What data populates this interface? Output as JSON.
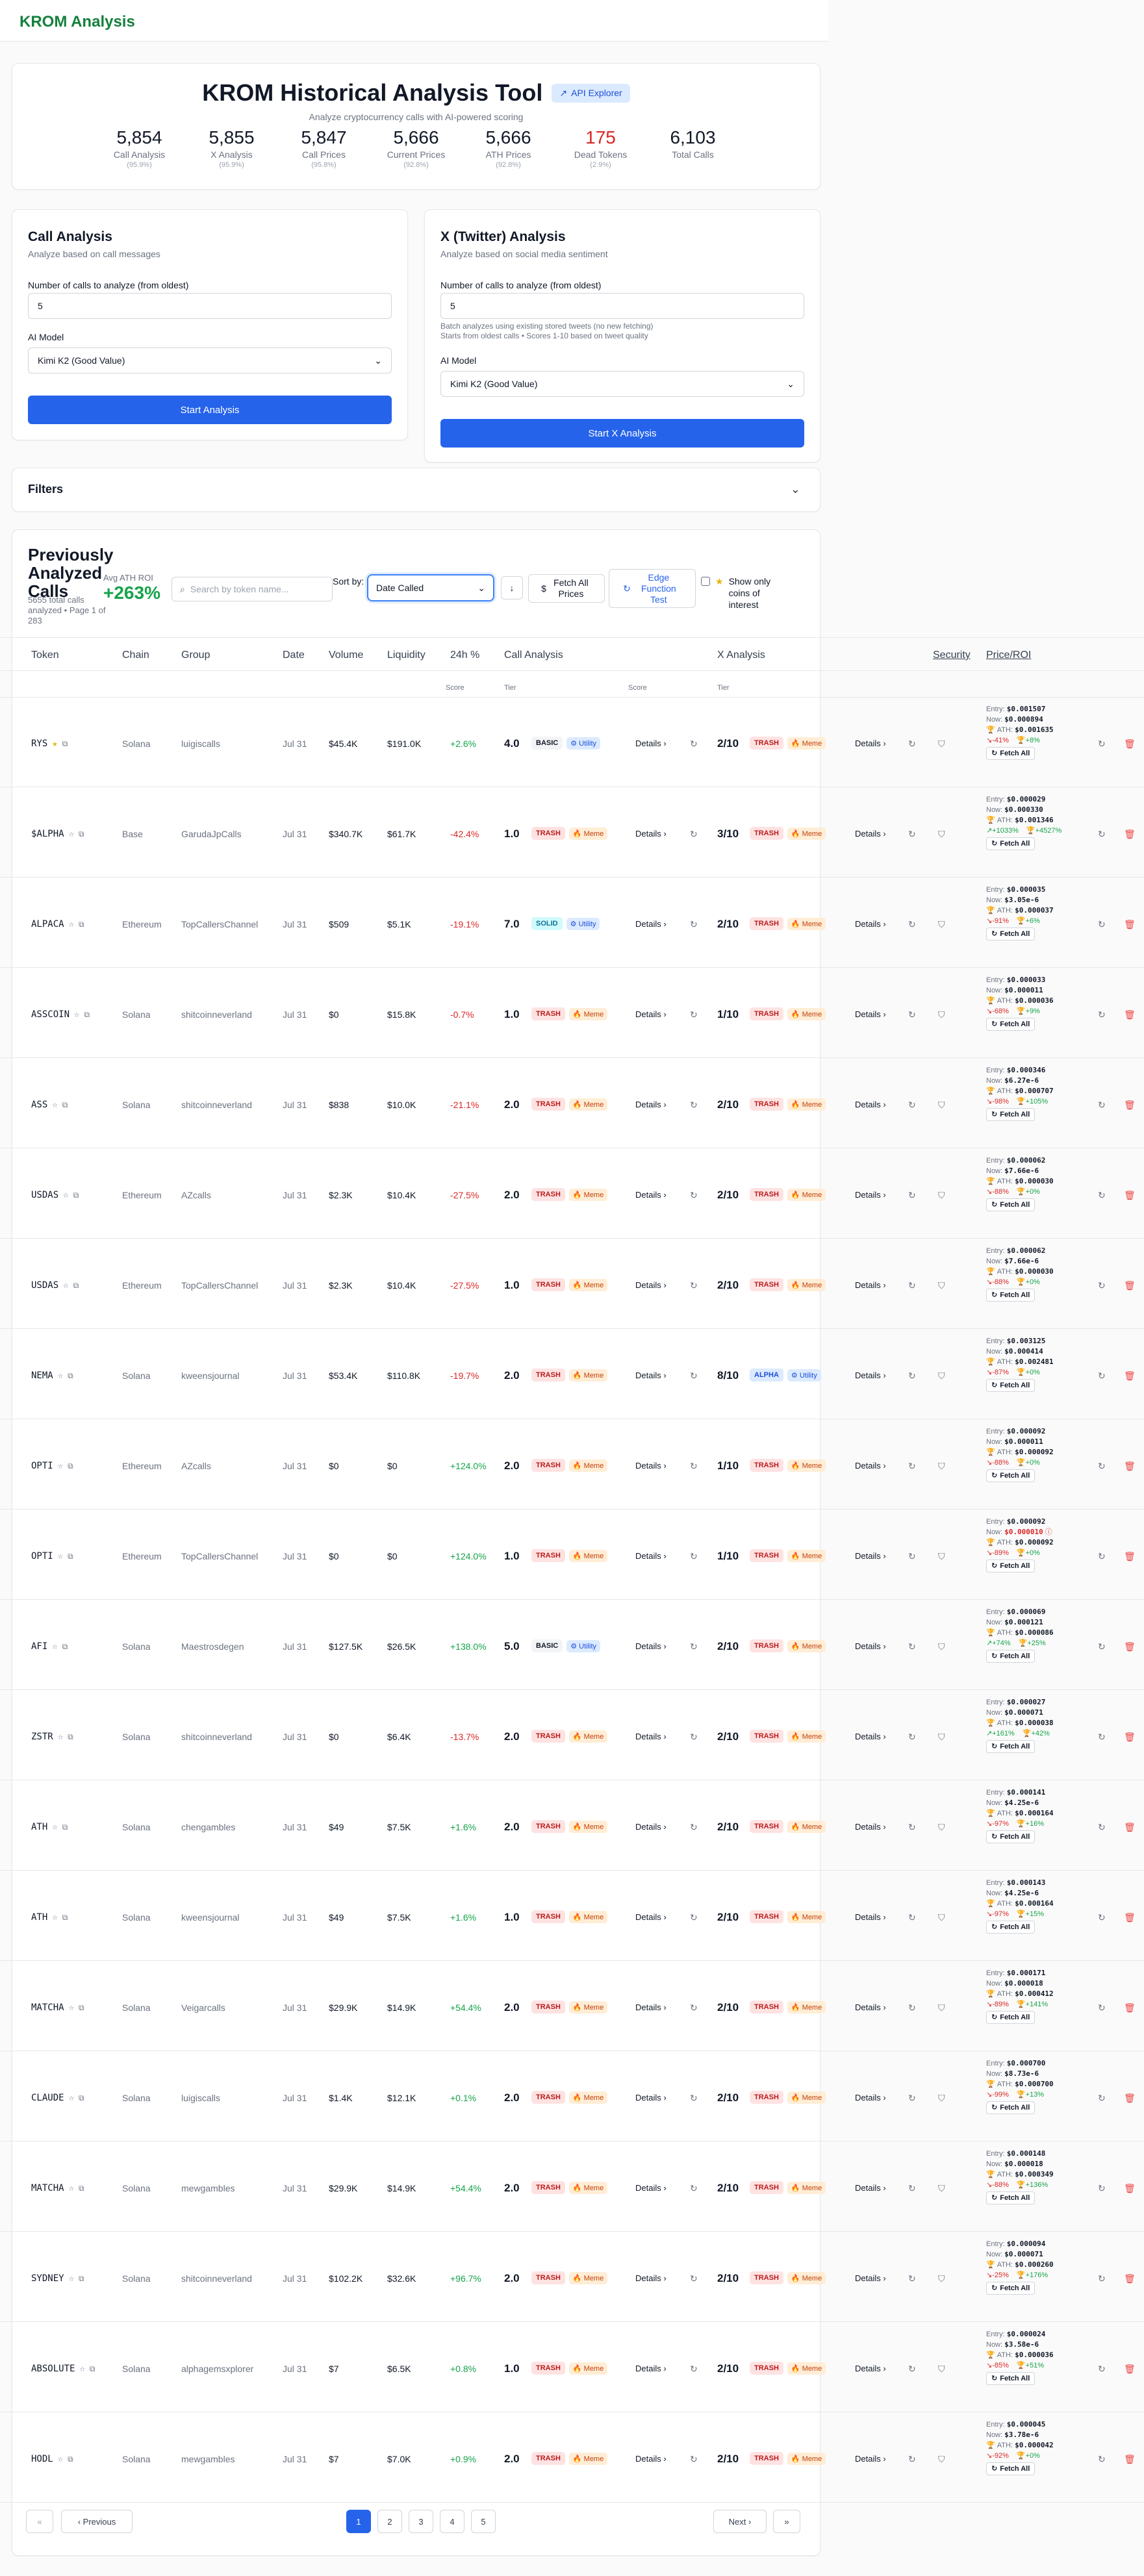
{
  "app": {
    "title": "KROM Analysis"
  },
  "hero": {
    "title": "KROM Historical Analysis Tool",
    "api_explorer": "API Explorer",
    "subtitle": "Analyze cryptocurrency calls with AI-powered scoring",
    "stats": [
      {
        "value": "5,854",
        "label": "Call Analysis",
        "pct": "(95.9%)"
      },
      {
        "value": "5,855",
        "label": "X Analysis",
        "pct": "(95.9%)"
      },
      {
        "value": "5,847",
        "label": "Call Prices",
        "pct": "(95.8%)"
      },
      {
        "value": "5,666",
        "label": "Current Prices",
        "pct": "(92.8%)"
      },
      {
        "value": "5,666",
        "label": "ATH Prices",
        "pct": "(92.8%)"
      },
      {
        "value": "175",
        "label": "Dead Tokens",
        "pct": "(2.9%)"
      },
      {
        "value": "6,103",
        "label": "Total Calls",
        "pct": ""
      }
    ]
  },
  "call_analysis": {
    "title": "Call Analysis",
    "subtitle": "Analyze based on call messages",
    "count_label": "Number of calls to analyze (from oldest)",
    "count_value": "5",
    "model_label": "AI Model",
    "model_value": "Kimi K2 (Good Value)",
    "button": "Start Analysis"
  },
  "x_analysis": {
    "title": "X (Twitter) Analysis",
    "subtitle": "Analyze based on social media sentiment",
    "count_label": "Number of calls to analyze (from oldest)",
    "count_value": "5",
    "hint1": "Batch analyzes using existing stored tweets (no new fetching)",
    "hint2": "Starts from oldest calls • Scores 1-10 based on tweet quality",
    "model_label": "AI Model",
    "model_value": "Kimi K2 (Good Value)",
    "button": "Start X Analysis"
  },
  "filters": {
    "label": "Filters"
  },
  "table_header": {
    "title": "Previously Analyzed Calls",
    "meta": "5655 total calls analyzed • Page 1 of 283",
    "roi_label": "Avg ATH ROI",
    "roi_value": "+263%",
    "search_placeholder": "Search by token name...",
    "sort_label": "Sort by:",
    "sort_value": "Date Called",
    "fetch_all": "Fetch All Prices",
    "edge_test": "Edge Function Test",
    "interest_label": "Show only coins of interest"
  },
  "columns": {
    "token": "Token",
    "chain": "Chain",
    "group": "Group",
    "date": "Date",
    "volume": "Volume",
    "liquidity": "Liquidity",
    "change": "24h %",
    "call_analysis": "Call Analysis",
    "x_analysis": "X Analysis",
    "security": "Security",
    "price": "Price/ROI",
    "score": "Score",
    "tier": "Tier"
  },
  "labels": {
    "details": "Details ›",
    "entry": "Entry:",
    "now": "Now:",
    "ath": "ATH:",
    "fetch_all": "Fetch All"
  },
  "rows": [
    {
      "token": "RYS",
      "starred": true,
      "chain": "Solana",
      "group": "luigiscalls",
      "date": "Jul 31",
      "volume": "$45.4K",
      "liquidity": "$191.0K",
      "change": "+2.6%",
      "call_score": "4.0",
      "call_tier": "BASIC",
      "call_tag": "Utility",
      "x_score": "2/10",
      "x_tier": "TRASH",
      "x_tag": "Meme",
      "entry": "$0.001507",
      "now": "$0.000894",
      "now_red": false,
      "ath": "$0.001635",
      "roi_now": "-41%",
      "roi_ath": "+8%"
    },
    {
      "token": "$ALPHA",
      "starred": false,
      "chain": "Base",
      "group": "GarudaJpCalls",
      "date": "Jul 31",
      "volume": "$340.7K",
      "liquidity": "$61.7K",
      "change": "-42.4%",
      "call_score": "1.0",
      "call_tier": "TRASH",
      "call_tag": "Meme",
      "x_score": "3/10",
      "x_tier": "TRASH",
      "x_tag": "Meme",
      "entry": "$0.000029",
      "now": "$0.000330",
      "now_red": false,
      "ath": "$0.001346",
      "roi_now": "+1033%",
      "roi_ath": "+4527%"
    },
    {
      "token": "ALPACA",
      "starred": false,
      "chain": "Ethereum",
      "group": "TopCallersChannel",
      "date": "Jul 31",
      "volume": "$509",
      "liquidity": "$5.1K",
      "change": "-19.1%",
      "call_score": "7.0",
      "call_tier": "SOLID",
      "call_tag": "Utility",
      "x_score": "2/10",
      "x_tier": "TRASH",
      "x_tag": "Meme",
      "entry": "$0.000035",
      "now": "$3.05e-6",
      "now_red": false,
      "ath": "$0.000037",
      "roi_now": "-91%",
      "roi_ath": "+6%"
    },
    {
      "token": "ASSCOIN",
      "starred": false,
      "chain": "Solana",
      "group": "shitcoinneverland",
      "date": "Jul 31",
      "volume": "$0",
      "liquidity": "$15.8K",
      "change": "-0.7%",
      "call_score": "1.0",
      "call_tier": "TRASH",
      "call_tag": "Meme",
      "x_score": "1/10",
      "x_tier": "TRASH",
      "x_tag": "Meme",
      "entry": "$0.000033",
      "now": "$0.000011",
      "now_red": false,
      "ath": "$0.000036",
      "roi_now": "-68%",
      "roi_ath": "+9%"
    },
    {
      "token": "ASS",
      "starred": false,
      "chain": "Solana",
      "group": "shitcoinneverland",
      "date": "Jul 31",
      "volume": "$838",
      "liquidity": "$10.0K",
      "change": "-21.1%",
      "call_score": "2.0",
      "call_tier": "TRASH",
      "call_tag": "Meme",
      "x_score": "2/10",
      "x_tier": "TRASH",
      "x_tag": "Meme",
      "entry": "$0.000346",
      "now": "$6.27e-6",
      "now_red": false,
      "ath": "$0.000707",
      "roi_now": "-98%",
      "roi_ath": "+105%"
    },
    {
      "token": "USDAS",
      "starred": false,
      "chain": "Ethereum",
      "group": "AZcalls",
      "date": "Jul 31",
      "volume": "$2.3K",
      "liquidity": "$10.4K",
      "change": "-27.5%",
      "call_score": "2.0",
      "call_tier": "TRASH",
      "call_tag": "Meme",
      "x_score": "2/10",
      "x_tier": "TRASH",
      "x_tag": "Meme",
      "entry": "$0.000062",
      "now": "$7.66e-6",
      "now_red": false,
      "ath": "$0.000030",
      "roi_now": "-88%",
      "roi_ath": "+0%"
    },
    {
      "token": "USDAS",
      "starred": false,
      "chain": "Ethereum",
      "group": "TopCallersChannel",
      "date": "Jul 31",
      "volume": "$2.3K",
      "liquidity": "$10.4K",
      "change": "-27.5%",
      "call_score": "1.0",
      "call_tier": "TRASH",
      "call_tag": "Meme",
      "x_score": "2/10",
      "x_tier": "TRASH",
      "x_tag": "Meme",
      "entry": "$0.000062",
      "now": "$7.66e-6",
      "now_red": false,
      "ath": "$0.000030",
      "roi_now": "-88%",
      "roi_ath": "+0%"
    },
    {
      "token": "NEMA",
      "starred": false,
      "chain": "Solana",
      "group": "kweensjournal",
      "date": "Jul 31",
      "volume": "$53.4K",
      "liquidity": "$110.8K",
      "change": "-19.7%",
      "call_score": "2.0",
      "call_tier": "TRASH",
      "call_tag": "Meme",
      "x_score": "8/10",
      "x_tier": "ALPHA",
      "x_tag": "Utility",
      "entry": "$0.003125",
      "now": "$0.000414",
      "now_red": false,
      "ath": "$0.002481",
      "roi_now": "-87%",
      "roi_ath": "+0%"
    },
    {
      "token": "OPTI",
      "starred": false,
      "chain": "Ethereum",
      "group": "AZcalls",
      "date": "Jul 31",
      "volume": "$0",
      "liquidity": "$0",
      "change": "+124.0%",
      "call_score": "2.0",
      "call_tier": "TRASH",
      "call_tag": "Meme",
      "x_score": "1/10",
      "x_tier": "TRASH",
      "x_tag": "Meme",
      "entry": "$0.000092",
      "now": "$0.000011",
      "now_red": false,
      "ath": "$0.000092",
      "roi_now": "-88%",
      "roi_ath": "+0%"
    },
    {
      "token": "OPTI",
      "starred": false,
      "chain": "Ethereum",
      "group": "TopCallersChannel",
      "date": "Jul 31",
      "volume": "$0",
      "liquidity": "$0",
      "change": "+124.0%",
      "call_score": "1.0",
      "call_tier": "TRASH",
      "call_tag": "Meme",
      "x_score": "1/10",
      "x_tier": "TRASH",
      "x_tag": "Meme",
      "entry": "$0.000092",
      "now": "$0.000010",
      "now_red": true,
      "ath": "$0.000092",
      "roi_now": "-89%",
      "roi_ath": "+0%"
    },
    {
      "token": "AFI",
      "starred": false,
      "chain": "Solana",
      "group": "Maestrosdegen",
      "date": "Jul 31",
      "volume": "$127.5K",
      "liquidity": "$26.5K",
      "change": "+138.0%",
      "call_score": "5.0",
      "call_tier": "BASIC",
      "call_tag": "Utility",
      "x_score": "2/10",
      "x_tier": "TRASH",
      "x_tag": "Meme",
      "entry": "$0.000069",
      "now": "$0.000121",
      "now_red": false,
      "ath": "$0.000086",
      "roi_now": "+74%",
      "roi_ath": "+25%"
    },
    {
      "token": "ZSTR",
      "starred": false,
      "chain": "Solana",
      "group": "shitcoinneverland",
      "date": "Jul 31",
      "volume": "$0",
      "liquidity": "$6.4K",
      "change": "-13.7%",
      "call_score": "2.0",
      "call_tier": "TRASH",
      "call_tag": "Meme",
      "x_score": "2/10",
      "x_tier": "TRASH",
      "x_tag": "Meme",
      "entry": "$0.000027",
      "now": "$0.000071",
      "now_red": false,
      "ath": "$0.000038",
      "roi_now": "+161%",
      "roi_ath": "+42%"
    },
    {
      "token": "ATH",
      "starred": false,
      "chain": "Solana",
      "group": "chengambles",
      "date": "Jul 31",
      "volume": "$49",
      "liquidity": "$7.5K",
      "change": "+1.6%",
      "call_score": "2.0",
      "call_tier": "TRASH",
      "call_tag": "Meme",
      "x_score": "2/10",
      "x_tier": "TRASH",
      "x_tag": "Meme",
      "entry": "$0.000141",
      "now": "$4.25e-6",
      "now_red": false,
      "ath": "$0.000164",
      "roi_now": "-97%",
      "roi_ath": "+16%"
    },
    {
      "token": "ATH",
      "starred": false,
      "chain": "Solana",
      "group": "kweensjournal",
      "date": "Jul 31",
      "volume": "$49",
      "liquidity": "$7.5K",
      "change": "+1.6%",
      "call_score": "1.0",
      "call_tier": "TRASH",
      "call_tag": "Meme",
      "x_score": "2/10",
      "x_tier": "TRASH",
      "x_tag": "Meme",
      "entry": "$0.000143",
      "now": "$4.25e-6",
      "now_red": false,
      "ath": "$0.000164",
      "roi_now": "-97%",
      "roi_ath": "+15%"
    },
    {
      "token": "MATCHA",
      "starred": false,
      "chain": "Solana",
      "group": "Veigarcalls",
      "date": "Jul 31",
      "volume": "$29.9K",
      "liquidity": "$14.9K",
      "change": "+54.4%",
      "call_score": "2.0",
      "call_tier": "TRASH",
      "call_tag": "Meme",
      "x_score": "2/10",
      "x_tier": "TRASH",
      "x_tag": "Meme",
      "entry": "$0.000171",
      "now": "$0.000018",
      "now_red": false,
      "ath": "$0.000412",
      "roi_now": "-89%",
      "roi_ath": "+141%"
    },
    {
      "token": "CLAUDE",
      "starred": false,
      "chain": "Solana",
      "group": "luigiscalls",
      "date": "Jul 31",
      "volume": "$1.4K",
      "liquidity": "$12.1K",
      "change": "+0.1%",
      "call_score": "2.0",
      "call_tier": "TRASH",
      "call_tag": "Meme",
      "x_score": "2/10",
      "x_tier": "TRASH",
      "x_tag": "Meme",
      "entry": "$0.000700",
      "now": "$8.73e-6",
      "now_red": false,
      "ath": "$0.000700",
      "roi_now": "-99%",
      "roi_ath": "+13%"
    },
    {
      "token": "MATCHA",
      "starred": false,
      "chain": "Solana",
      "group": "mewgambles",
      "date": "Jul 31",
      "volume": "$29.9K",
      "liquidity": "$14.9K",
      "change": "+54.4%",
      "call_score": "2.0",
      "call_tier": "TRASH",
      "call_tag": "Meme",
      "x_score": "2/10",
      "x_tier": "TRASH",
      "x_tag": "Meme",
      "entry": "$0.000148",
      "now": "$0.000018",
      "now_red": false,
      "ath": "$0.000349",
      "roi_now": "-88%",
      "roi_ath": "+136%"
    },
    {
      "token": "SYDNEY",
      "starred": false,
      "chain": "Solana",
      "group": "shitcoinneverland",
      "date": "Jul 31",
      "volume": "$102.2K",
      "liquidity": "$32.6K",
      "change": "+96.7%",
      "call_score": "2.0",
      "call_tier": "TRASH",
      "call_tag": "Meme",
      "x_score": "2/10",
      "x_tier": "TRASH",
      "x_tag": "Meme",
      "entry": "$0.000094",
      "now": "$0.000071",
      "now_red": false,
      "ath": "$0.000260",
      "roi_now": "-25%",
      "roi_ath": "+176%"
    },
    {
      "token": "ABSOLUTE",
      "starred": false,
      "chain": "Solana",
      "group": "alphagemsxplorer",
      "date": "Jul 31",
      "volume": "$7",
      "liquidity": "$6.5K",
      "change": "+0.8%",
      "call_score": "1.0",
      "call_tier": "TRASH",
      "call_tag": "Meme",
      "x_score": "2/10",
      "x_tier": "TRASH",
      "x_tag": "Meme",
      "entry": "$0.000024",
      "now": "$3.58e-6",
      "now_red": false,
      "ath": "$0.000036",
      "roi_now": "-85%",
      "roi_ath": "+51%"
    },
    {
      "token": "HODL",
      "starred": false,
      "chain": "Solana",
      "group": "mewgambles",
      "date": "Jul 31",
      "volume": "$7",
      "liquidity": "$7.0K",
      "change": "+0.9%",
      "call_score": "2.0",
      "call_tier": "TRASH",
      "call_tag": "Meme",
      "x_score": "2/10",
      "x_tier": "TRASH",
      "x_tag": "Meme",
      "entry": "$0.000045",
      "now": "$3.78e-6",
      "now_red": false,
      "ath": "$0.000042",
      "roi_now": "-92%",
      "roi_ath": "+0%"
    }
  ],
  "pagination": {
    "first": "«",
    "previous": "‹ Previous",
    "pages": [
      "1",
      "2",
      "3",
      "4",
      "5"
    ],
    "current": "1",
    "next": "Next ›",
    "last": "»"
  }
}
